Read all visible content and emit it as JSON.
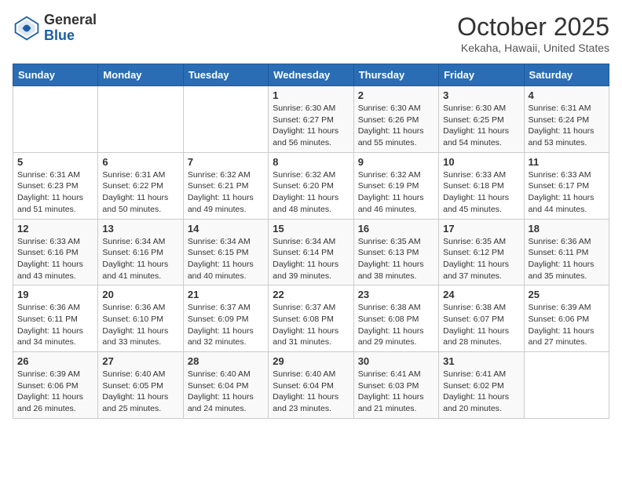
{
  "header": {
    "logo_line1": "General",
    "logo_line2": "Blue",
    "month_title": "October 2025",
    "subtitle": "Kekaha, Hawaii, United States"
  },
  "weekdays": [
    "Sunday",
    "Monday",
    "Tuesday",
    "Wednesday",
    "Thursday",
    "Friday",
    "Saturday"
  ],
  "weeks": [
    [
      {
        "day": "",
        "info": ""
      },
      {
        "day": "",
        "info": ""
      },
      {
        "day": "",
        "info": ""
      },
      {
        "day": "1",
        "info": "Sunrise: 6:30 AM\nSunset: 6:27 PM\nDaylight: 11 hours\nand 56 minutes."
      },
      {
        "day": "2",
        "info": "Sunrise: 6:30 AM\nSunset: 6:26 PM\nDaylight: 11 hours\nand 55 minutes."
      },
      {
        "day": "3",
        "info": "Sunrise: 6:30 AM\nSunset: 6:25 PM\nDaylight: 11 hours\nand 54 minutes."
      },
      {
        "day": "4",
        "info": "Sunrise: 6:31 AM\nSunset: 6:24 PM\nDaylight: 11 hours\nand 53 minutes."
      }
    ],
    [
      {
        "day": "5",
        "info": "Sunrise: 6:31 AM\nSunset: 6:23 PM\nDaylight: 11 hours\nand 51 minutes."
      },
      {
        "day": "6",
        "info": "Sunrise: 6:31 AM\nSunset: 6:22 PM\nDaylight: 11 hours\nand 50 minutes."
      },
      {
        "day": "7",
        "info": "Sunrise: 6:32 AM\nSunset: 6:21 PM\nDaylight: 11 hours\nand 49 minutes."
      },
      {
        "day": "8",
        "info": "Sunrise: 6:32 AM\nSunset: 6:20 PM\nDaylight: 11 hours\nand 48 minutes."
      },
      {
        "day": "9",
        "info": "Sunrise: 6:32 AM\nSunset: 6:19 PM\nDaylight: 11 hours\nand 46 minutes."
      },
      {
        "day": "10",
        "info": "Sunrise: 6:33 AM\nSunset: 6:18 PM\nDaylight: 11 hours\nand 45 minutes."
      },
      {
        "day": "11",
        "info": "Sunrise: 6:33 AM\nSunset: 6:17 PM\nDaylight: 11 hours\nand 44 minutes."
      }
    ],
    [
      {
        "day": "12",
        "info": "Sunrise: 6:33 AM\nSunset: 6:16 PM\nDaylight: 11 hours\nand 43 minutes."
      },
      {
        "day": "13",
        "info": "Sunrise: 6:34 AM\nSunset: 6:16 PM\nDaylight: 11 hours\nand 41 minutes."
      },
      {
        "day": "14",
        "info": "Sunrise: 6:34 AM\nSunset: 6:15 PM\nDaylight: 11 hours\nand 40 minutes."
      },
      {
        "day": "15",
        "info": "Sunrise: 6:34 AM\nSunset: 6:14 PM\nDaylight: 11 hours\nand 39 minutes."
      },
      {
        "day": "16",
        "info": "Sunrise: 6:35 AM\nSunset: 6:13 PM\nDaylight: 11 hours\nand 38 minutes."
      },
      {
        "day": "17",
        "info": "Sunrise: 6:35 AM\nSunset: 6:12 PM\nDaylight: 11 hours\nand 37 minutes."
      },
      {
        "day": "18",
        "info": "Sunrise: 6:36 AM\nSunset: 6:11 PM\nDaylight: 11 hours\nand 35 minutes."
      }
    ],
    [
      {
        "day": "19",
        "info": "Sunrise: 6:36 AM\nSunset: 6:11 PM\nDaylight: 11 hours\nand 34 minutes."
      },
      {
        "day": "20",
        "info": "Sunrise: 6:36 AM\nSunset: 6:10 PM\nDaylight: 11 hours\nand 33 minutes."
      },
      {
        "day": "21",
        "info": "Sunrise: 6:37 AM\nSunset: 6:09 PM\nDaylight: 11 hours\nand 32 minutes."
      },
      {
        "day": "22",
        "info": "Sunrise: 6:37 AM\nSunset: 6:08 PM\nDaylight: 11 hours\nand 31 minutes."
      },
      {
        "day": "23",
        "info": "Sunrise: 6:38 AM\nSunset: 6:08 PM\nDaylight: 11 hours\nand 29 minutes."
      },
      {
        "day": "24",
        "info": "Sunrise: 6:38 AM\nSunset: 6:07 PM\nDaylight: 11 hours\nand 28 minutes."
      },
      {
        "day": "25",
        "info": "Sunrise: 6:39 AM\nSunset: 6:06 PM\nDaylight: 11 hours\nand 27 minutes."
      }
    ],
    [
      {
        "day": "26",
        "info": "Sunrise: 6:39 AM\nSunset: 6:06 PM\nDaylight: 11 hours\nand 26 minutes."
      },
      {
        "day": "27",
        "info": "Sunrise: 6:40 AM\nSunset: 6:05 PM\nDaylight: 11 hours\nand 25 minutes."
      },
      {
        "day": "28",
        "info": "Sunrise: 6:40 AM\nSunset: 6:04 PM\nDaylight: 11 hours\nand 24 minutes."
      },
      {
        "day": "29",
        "info": "Sunrise: 6:40 AM\nSunset: 6:04 PM\nDaylight: 11 hours\nand 23 minutes."
      },
      {
        "day": "30",
        "info": "Sunrise: 6:41 AM\nSunset: 6:03 PM\nDaylight: 11 hours\nand 21 minutes."
      },
      {
        "day": "31",
        "info": "Sunrise: 6:41 AM\nSunset: 6:02 PM\nDaylight: 11 hours\nand 20 minutes."
      },
      {
        "day": "",
        "info": ""
      }
    ]
  ]
}
